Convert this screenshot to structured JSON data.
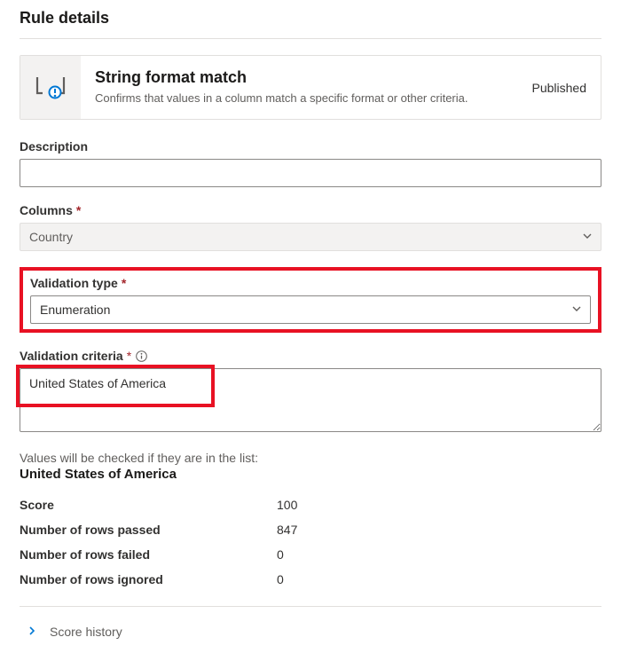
{
  "page": {
    "title": "Rule details"
  },
  "rule": {
    "title": "String format match",
    "description": "Confirms that values in a column match a specific format or other criteria.",
    "status": "Published"
  },
  "fields": {
    "description_label": "Description",
    "description_value": "",
    "columns_label": "Columns",
    "columns_value": "Country",
    "validation_type_label": "Validation type",
    "validation_type_value": "Enumeration",
    "validation_criteria_label": "Validation criteria",
    "validation_criteria_value": "United States of America"
  },
  "check": {
    "prefix": "Values will be checked if they are in the list:",
    "value": "United States of America"
  },
  "stats": {
    "score_label": "Score",
    "score_value": "100",
    "rows_passed_label": "Number of rows passed",
    "rows_passed_value": "847",
    "rows_failed_label": "Number of rows failed",
    "rows_failed_value": "0",
    "rows_ignored_label": "Number of rows ignored",
    "rows_ignored_value": "0"
  },
  "history": {
    "label": "Score history"
  }
}
